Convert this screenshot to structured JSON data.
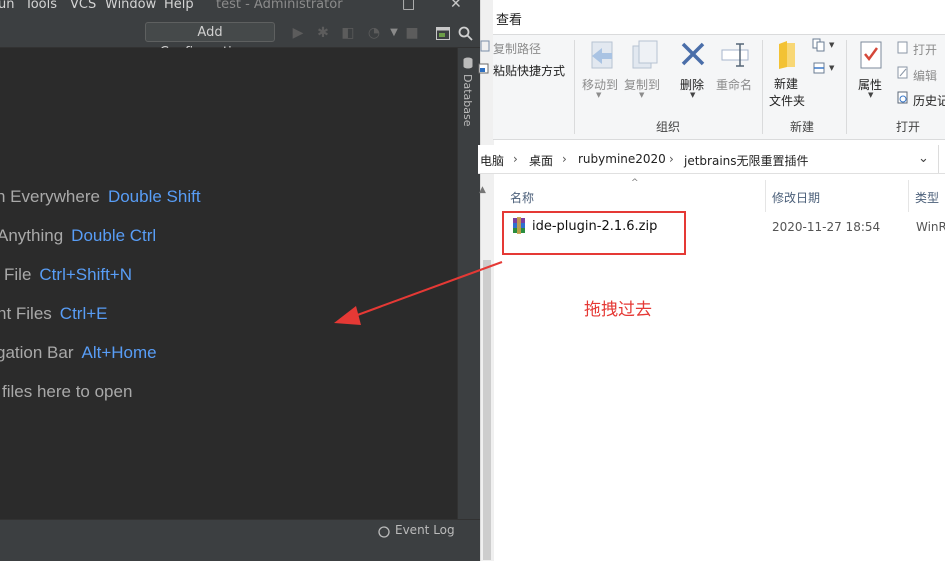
{
  "ide": {
    "menu": [
      "un",
      "Tools",
      "VCS",
      "Window",
      "Help"
    ],
    "title": "test - Administrator",
    "add_configuration": "Add Configuration...",
    "hints": [
      {
        "text": "h Everywhere",
        "key": "Double Shift"
      },
      {
        "text": "Anything",
        "key": "Double Ctrl"
      },
      {
        "text": "File",
        "key": "Ctrl+Shift+N"
      },
      {
        "text": "nt Files",
        "key": "Ctrl+E"
      },
      {
        "text": "gation Bar",
        "key": "Alt+Home"
      },
      {
        "text": "files here to open",
        "key": ""
      }
    ],
    "sidebar_label": "Database",
    "event_log": "Event Log",
    "icons": [
      "run-icon",
      "debug-icon",
      "coverage-icon",
      "profile-icon",
      "stop-icon",
      "terminal-icon",
      "search-icon"
    ]
  },
  "explorer": {
    "tab_view": "查看",
    "ribbon": {
      "copy_path": "复制路径",
      "paste_shortcut": "粘贴快捷方式",
      "move_to": "移动到",
      "copy_to": "复制到",
      "delete": "删除",
      "rename": "重命名",
      "group_organize": "组织",
      "new_folder": "新建\n文件夹",
      "group_new": "新建",
      "properties": "属性",
      "open": "打开",
      "edit": "编辑",
      "history": "历史记",
      "group_open": "打开"
    },
    "breadcrumb": [
      "电脑",
      "桌面",
      "rubymine2020",
      "jetbrains无限重置插件"
    ],
    "columns": {
      "name": "名称",
      "date": "修改日期",
      "type": "类型"
    },
    "file": {
      "name": "ide-plugin-2.1.6.zip",
      "date": "2020-11-27 18:54",
      "type": "WinR"
    }
  },
  "annotation": {
    "drag_text": "拖拽过去",
    "color": "#e53935"
  }
}
